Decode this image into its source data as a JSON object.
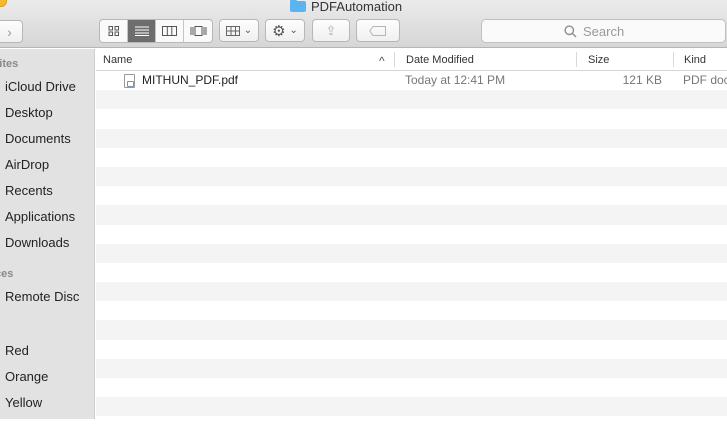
{
  "window": {
    "title": "PDFAutomation"
  },
  "toolbar": {
    "forward_glyph": "›",
    "search_placeholder": "Search",
    "share_glyph": "⇪",
    "action_glyph": "⚙",
    "dropdown_glyph": "⌄",
    "view_modes": [
      "icon-view",
      "list-view",
      "column-view",
      "cover-flow-view"
    ],
    "active_view": "list-view"
  },
  "sidebar": {
    "sections": [
      {
        "label": "rites"
      },
      {
        "label": "ces"
      }
    ],
    "items": [
      {
        "label": "iCloud Drive"
      },
      {
        "label": "Desktop"
      },
      {
        "label": "Documents"
      },
      {
        "label": "AirDrop"
      },
      {
        "label": "Recents"
      },
      {
        "label": "Applications"
      },
      {
        "label": "Downloads"
      },
      {
        "label": "Remote Disc"
      },
      {
        "label": "Red"
      },
      {
        "label": "Orange"
      },
      {
        "label": "Yellow"
      }
    ]
  },
  "list": {
    "columns": [
      {
        "label": "Name",
        "sort_indicator": "^"
      },
      {
        "label": "Date Modified"
      },
      {
        "label": "Size"
      },
      {
        "label": "Kind"
      }
    ],
    "files": [
      {
        "name": "MITHUN_PDF.pdf",
        "date_modified": "Today at 12:41 PM",
        "size": "121 KB",
        "kind": "PDF doc",
        "icon": "pdf-file-icon"
      }
    ]
  }
}
